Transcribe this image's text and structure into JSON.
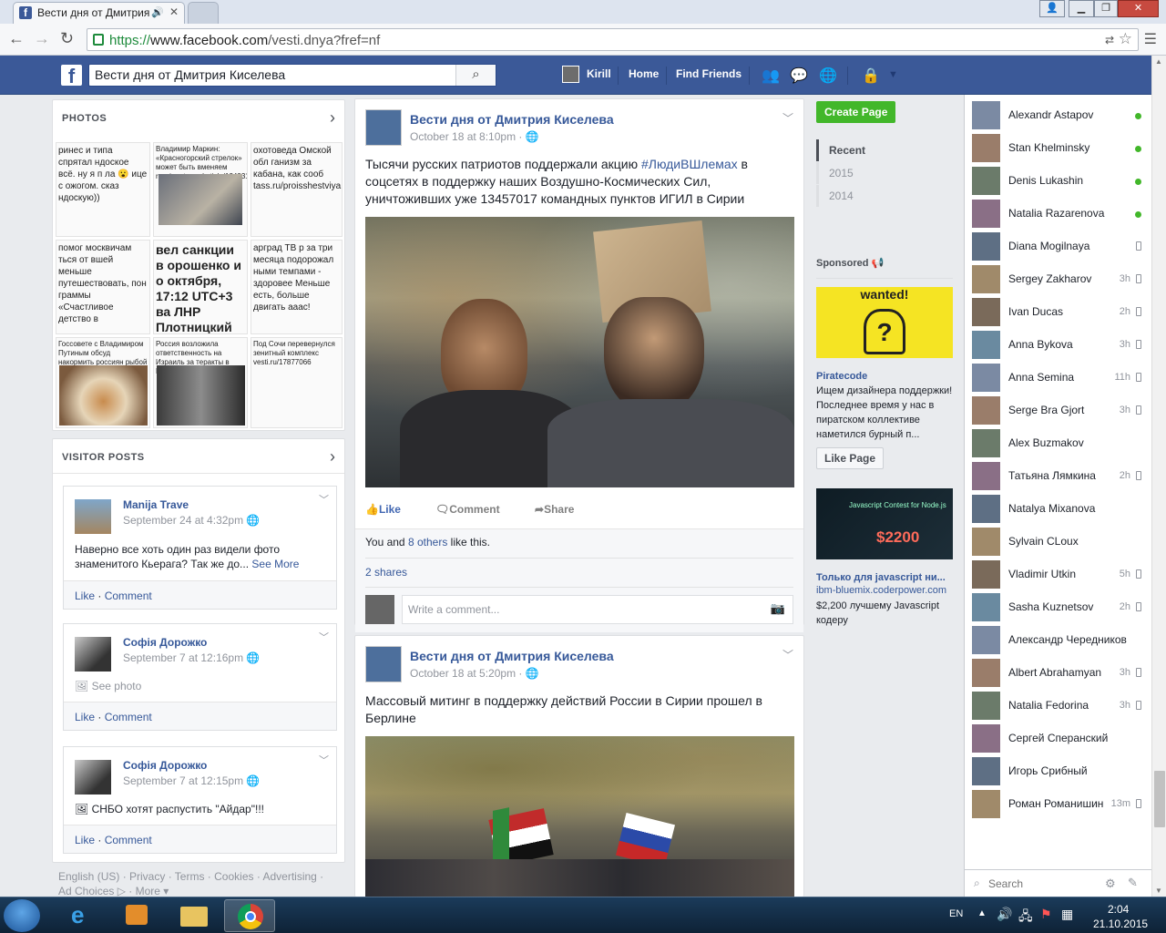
{
  "browser": {
    "tab_active_title": "Вести дня от Дмитрия",
    "tab_inactive_title": "",
    "url_scheme": "https://",
    "url_host": "www.facebook.com",
    "url_path": "/vesti.dnya?fref=nf"
  },
  "fb_header": {
    "search_value": "Вести дня от Дмитрия Киселева",
    "profile_name": "Kirill",
    "home_label": "Home",
    "find_friends_label": "Find Friends"
  },
  "photos": {
    "title": "PHOTOS",
    "thumbs": [
      "ринес и типа спрятал ндоское всё. ну я п ла 😮 ице с ожогом. сказ ндоскую))",
      "Владимир Маркин: «Красногорский стрелок» может быть вменяем russian.rt.com/article/124931",
      "охотоведа Омской обл ганизм за кабана, как сооб tass.ru/proisshestviya",
      "помог москвичам ться от вшей меньше путешествовать, пон граммы «Счастливое детство в",
      "вел санкции в орошенко и о октября, 17:12 UTC+3 ва ЛНР Плотницкий",
      "арград ТВ р за три месяца подорожал ными темпами - здоровее Меньше есть, больше двигать ааас!",
      "Госсовете с Владимиром Путиным обсуд накормить россиян рыбой",
      "Россия возложила ответственность на Израиль за теракты в Иерусалиме",
      "Под Сочи перевернулся зенитный комплекс vesti.ru/17877066"
    ]
  },
  "visitor_posts": {
    "title": "VISITOR POSTS",
    "posts": [
      {
        "name": "Manija Trave",
        "time": "September 24 at 4:32pm",
        "text": "Наверно все хоть один раз видели фото знаменитого Кьерага? Так же до...",
        "see_more": "See More",
        "like": "Like",
        "comment": "Comment"
      },
      {
        "name": "Софія Дорожко",
        "time": "September 7 at 12:16pm",
        "text": "See photo",
        "like": "Like",
        "comment": "Comment"
      },
      {
        "name": "Софія Дорожко",
        "time": "September 7 at 12:15pm",
        "text": "СНБО хотят распустить \"Айдар\"!!!",
        "like": "Like",
        "comment": "Comment"
      }
    ]
  },
  "footer": {
    "line1": "English (US) · Privacy · Terms · Cookies · Advertising ·",
    "line2": "Ad Choices ▷ · More ▾"
  },
  "feed": {
    "posts": [
      {
        "page_name": "Вести дня от Дмитрия Киселева",
        "time": "October 18 at 8:10pm · 🌐",
        "text_before": "Тысячи русских патриотов поддержали акцию ",
        "hashtag": "#ЛюдиВШлемах",
        "text_after": " в соцсетях в поддержку наших Воздушно-Космических Сил, уничтоживших уже 13457017 командных пунктов ИГИЛ в Сирии",
        "like": "Like",
        "comment": "Comment",
        "share": "Share",
        "likes_prefix": "You and ",
        "likes_link": "8 others",
        "likes_suffix": " like this.",
        "shares": "2 shares",
        "comment_placeholder": "Write a comment..."
      },
      {
        "page_name": "Вести дня от Дмитрия Киселева",
        "time": "October 18 at 5:20pm · 🌐",
        "text": "Массовый митинг в поддержку действий России в Сирии прошел в Берлине"
      }
    ]
  },
  "right": {
    "create_page": "Create Page",
    "years": [
      "Recent",
      "2015",
      "2014"
    ],
    "sponsored": "Sponsored",
    "ad1": {
      "image_text": "wanted!",
      "title": "Piratecode",
      "text": "Ищем дизайнера поддержки! Последнее время у нас в пиратском коллективе наметился бурный п...",
      "button": "Like Page"
    },
    "ad2": {
      "image_text": "$2200",
      "image_sub": "Javascript Contest for Node.js",
      "title": "Только для javascript ни...",
      "domain": "ibm-bluemix.coderpower.com",
      "text": "$2,200 лучшему Javascript кодеру"
    }
  },
  "chat": {
    "contacts": [
      {
        "name": "Alexandr Astapov",
        "status": "online"
      },
      {
        "name": "Stan Khelminsky",
        "status": "online"
      },
      {
        "name": "Denis Lukashin",
        "status": "online"
      },
      {
        "name": "Natalia Razarenova",
        "status": "online"
      },
      {
        "name": "Diana Mogilnaya",
        "status": "mobile",
        "time": ""
      },
      {
        "name": "Sergey Zakharov",
        "status": "mobile",
        "time": "3h"
      },
      {
        "name": "Ivan Ducas",
        "status": "mobile",
        "time": "2h"
      },
      {
        "name": "Anna Bykova",
        "status": "mobile",
        "time": "3h"
      },
      {
        "name": "Anna Semina",
        "status": "mobile",
        "time": "11h"
      },
      {
        "name": "Serge Bra Gjort",
        "status": "mobile",
        "time": "3h"
      },
      {
        "name": "Alex Buzmakov",
        "status": "none",
        "time": ""
      },
      {
        "name": "Татьяна Лямкина",
        "status": "mobile",
        "time": "2h"
      },
      {
        "name": "Natalya Mixanova",
        "status": "none",
        "time": ""
      },
      {
        "name": "Sylvain CLoux",
        "status": "none",
        "time": ""
      },
      {
        "name": "Vladimir Utkin",
        "status": "mobile",
        "time": "5h"
      },
      {
        "name": "Sasha Kuznetsov",
        "status": "mobile",
        "time": "2h"
      },
      {
        "name": "Александр Чередников",
        "status": "none",
        "time": ""
      },
      {
        "name": "Albert Abrahamyan",
        "status": "mobile",
        "time": "3h"
      },
      {
        "name": "Natalia Fedorina",
        "status": "mobile",
        "time": "3h"
      },
      {
        "name": "Сергей Сперанский",
        "status": "none",
        "time": ""
      },
      {
        "name": "Игорь Срибный",
        "status": "none",
        "time": ""
      },
      {
        "name": "Роман Романишин",
        "status": "mobile",
        "time": "13m"
      }
    ],
    "search_placeholder": "Search"
  },
  "taskbar": {
    "lang": "EN",
    "time": "2:04",
    "date": "21.10.2015"
  },
  "colors": {
    "fb_blue": "#3b5998",
    "link": "#365899",
    "green": "#42b72a"
  }
}
